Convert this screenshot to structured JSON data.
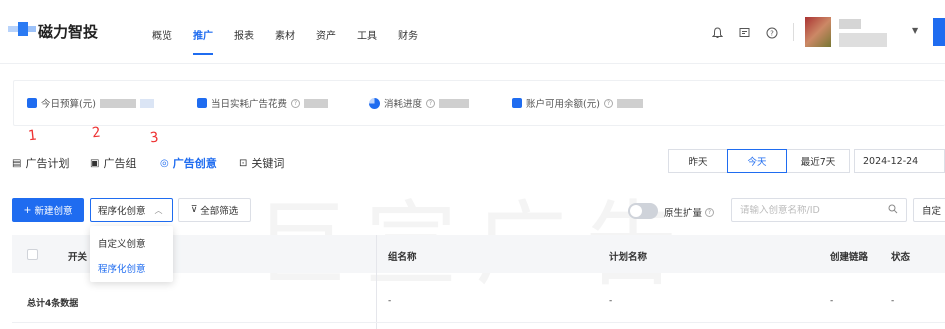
{
  "brand": {
    "name": "磁力智投"
  },
  "nav": {
    "items": [
      {
        "label": "概览",
        "active": false
      },
      {
        "label": "推广",
        "active": true
      },
      {
        "label": "报表",
        "active": false
      },
      {
        "label": "素材",
        "active": false
      },
      {
        "label": "资产",
        "active": false
      },
      {
        "label": "工具",
        "active": false
      },
      {
        "label": "财务",
        "active": false
      }
    ]
  },
  "toolbar_icons": [
    "bell-icon",
    "message-icon",
    "help-icon"
  ],
  "stats": [
    {
      "label": "今日预算(元)",
      "icon": "budget-icon"
    },
    {
      "label": "当日实耗广告花费",
      "icon": "spend-icon"
    },
    {
      "label": "消耗进度",
      "icon": "progress-pie-icon"
    },
    {
      "label": "账户可用余额(元)",
      "icon": "wallet-icon"
    }
  ],
  "annotations": [
    "1",
    "2",
    "3"
  ],
  "tabs": [
    {
      "label": "广告计划",
      "active": false,
      "icon": "plan-icon"
    },
    {
      "label": "广告组",
      "active": false,
      "icon": "group-icon"
    },
    {
      "label": "广告创意",
      "active": true,
      "icon": "creative-icon"
    },
    {
      "label": "关键词",
      "active": false,
      "icon": "keyword-icon"
    }
  ],
  "date_range": {
    "options": [
      "昨天",
      "今天",
      "最近7天"
    ],
    "active": "今天",
    "date": "2024-12-24"
  },
  "watermark": "巨宣广告",
  "actions": {
    "new_label": "新建创意",
    "type_selected": "程序化创意",
    "filter_label": "全部筛选",
    "toggle_label": "原生扩量",
    "toggle_on": false,
    "search_placeholder": "请输入创意名称/ID",
    "custom_label": "自定"
  },
  "dropdown": {
    "options": [
      "自定义创意",
      "程序化创意"
    ],
    "selected": "程序化创意"
  },
  "table": {
    "columns": [
      "开关",
      "组名称",
      "计划名称",
      "创建链路",
      "状态"
    ],
    "summary_row": {
      "label": "总计4条数据",
      "cells": [
        "-",
        "-",
        "-",
        "-"
      ]
    }
  },
  "colors": {
    "accent": "#1f6cf0",
    "annotation": "#e33333"
  }
}
